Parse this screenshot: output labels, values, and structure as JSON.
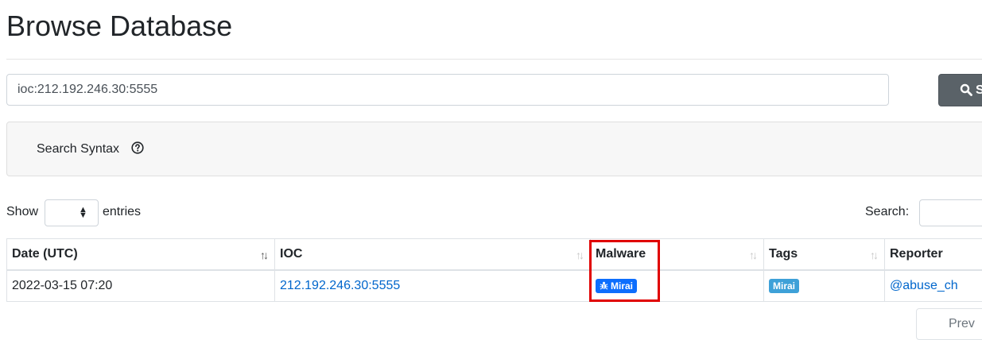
{
  "page": {
    "title": "Browse Database"
  },
  "search": {
    "value": "ioc:212.192.246.30:5555",
    "button_label": "S"
  },
  "syntax": {
    "label": "Search Syntax"
  },
  "table_controls": {
    "show_label": "Show",
    "entries_label": "entries",
    "search_label": "Search:"
  },
  "table": {
    "headers": [
      "Date (UTC)",
      "IOC",
      "Malware",
      "Tags",
      "Reporter"
    ],
    "rows": [
      {
        "date": "2022-03-15 07:20",
        "ioc": "212.192.246.30:5555",
        "malware": "Mirai",
        "tag": "Mirai",
        "reporter": "@abuse_ch"
      }
    ]
  },
  "pagination": {
    "next_label": "Prev"
  },
  "colors": {
    "malware_badge": "#0d6efd",
    "tag_badge": "#3ea1d8",
    "link": "#0066cc",
    "highlight": "#e00000"
  }
}
